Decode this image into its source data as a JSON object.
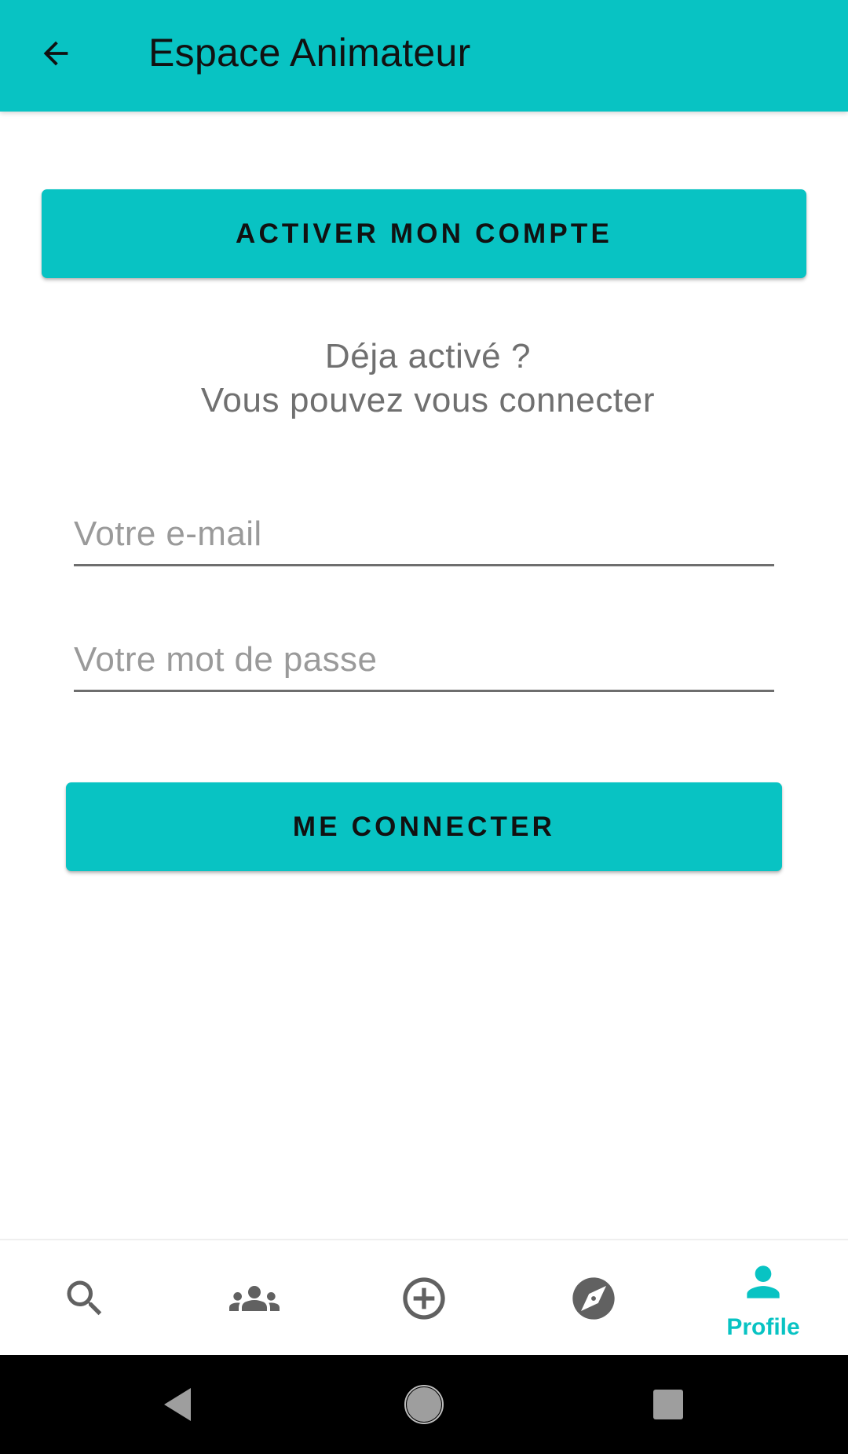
{
  "appbar": {
    "title": "Espace Animateur",
    "back_icon": "arrow-back-icon"
  },
  "activate_button": {
    "label": "ACTIVER MON COMPTE"
  },
  "info": {
    "line1": "Déja activé ?",
    "line2": "Vous pouvez vous connecter"
  },
  "form": {
    "email": {
      "placeholder": "Votre e-mail",
      "value": ""
    },
    "password": {
      "placeholder": "Votre mot de passe",
      "value": ""
    }
  },
  "connect_button": {
    "label": "ME CONNECTER"
  },
  "bottom_nav": {
    "items": [
      {
        "icon": "search-icon",
        "label": ""
      },
      {
        "icon": "groups-icon",
        "label": ""
      },
      {
        "icon": "add-circle-icon",
        "label": ""
      },
      {
        "icon": "explore-icon",
        "label": ""
      },
      {
        "icon": "person-icon",
        "label": "Profile",
        "active": true
      }
    ]
  },
  "colors": {
    "primary": "#08C3C3",
    "icon_inactive": "#616161",
    "text_secondary": "#707070"
  }
}
